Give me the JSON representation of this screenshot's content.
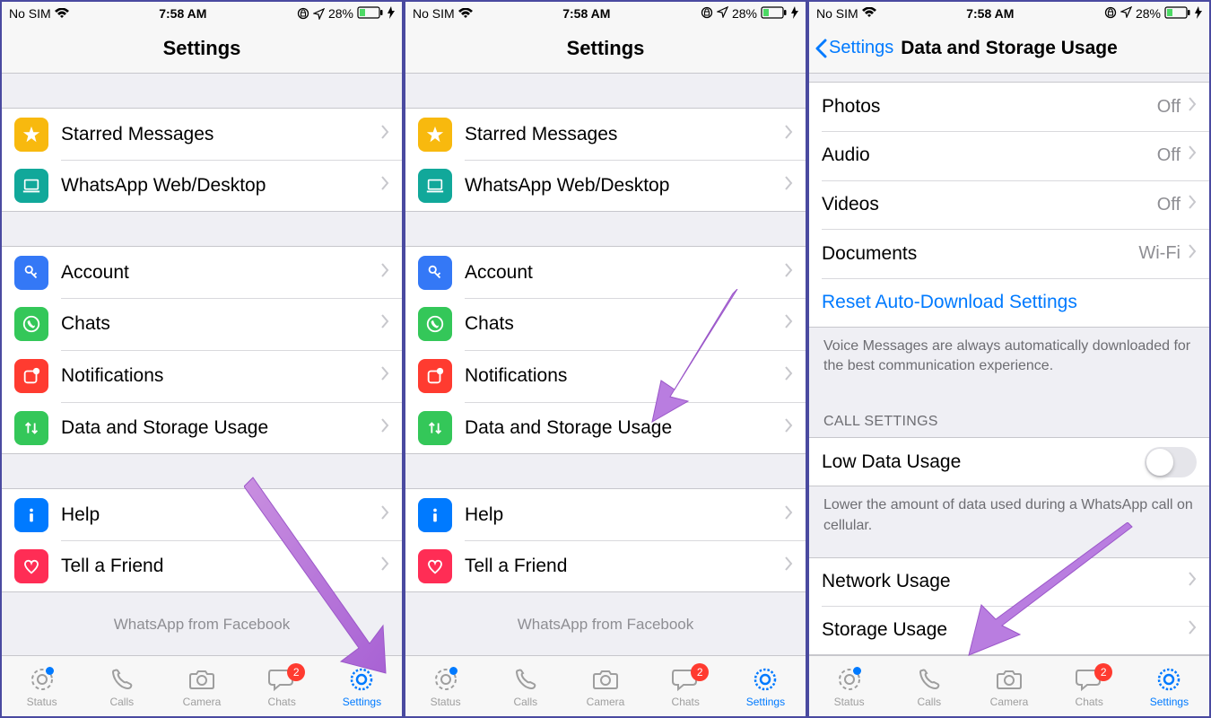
{
  "status_bar": {
    "carrier": "No SIM",
    "time": "7:58 AM",
    "battery_pct": "28%"
  },
  "screens": [
    {
      "nav": {
        "title": "Settings",
        "back": null
      },
      "brand": "WhatsApp from Facebook"
    },
    {
      "nav": {
        "title": "Settings",
        "back": null
      },
      "brand": "WhatsApp from Facebook"
    },
    {
      "nav": {
        "title": "Data and Storage Usage",
        "back": "Settings"
      }
    }
  ],
  "settings_group1": [
    {
      "label": "Starred Messages",
      "icon": "star",
      "color": "ic-yellow"
    },
    {
      "label": "WhatsApp Web/Desktop",
      "icon": "laptop",
      "color": "ic-teal"
    }
  ],
  "settings_group2": [
    {
      "label": "Account",
      "icon": "key",
      "color": "ic-blue"
    },
    {
      "label": "Chats",
      "icon": "whatsapp",
      "color": "ic-green"
    },
    {
      "label": "Notifications",
      "icon": "app-badge",
      "color": "ic-red"
    },
    {
      "label": "Data and Storage Usage",
      "icon": "arrows",
      "color": "ic-green"
    }
  ],
  "settings_group3": [
    {
      "label": "Help",
      "icon": "info",
      "color": "ic-info"
    },
    {
      "label": "Tell a Friend",
      "icon": "heart",
      "color": "ic-pink"
    }
  ],
  "data_usage": {
    "media": [
      {
        "label": "Photos",
        "value": "Off"
      },
      {
        "label": "Audio",
        "value": "Off"
      },
      {
        "label": "Videos",
        "value": "Off"
      },
      {
        "label": "Documents",
        "value": "Wi-Fi"
      }
    ],
    "reset_label": "Reset Auto-Download Settings",
    "voice_footer": "Voice Messages are always automatically downloaded for the best communication experience.",
    "call_header": "CALL SETTINGS",
    "low_data_label": "Low Data Usage",
    "low_data_footer": "Lower the amount of data used during a WhatsApp call on cellular.",
    "usage": [
      {
        "label": "Network Usage"
      },
      {
        "label": "Storage Usage"
      }
    ]
  },
  "tabs": [
    {
      "label": "Status",
      "icon": "status",
      "dot": true
    },
    {
      "label": "Calls",
      "icon": "phone"
    },
    {
      "label": "Camera",
      "icon": "camera"
    },
    {
      "label": "Chats",
      "icon": "chat",
      "badge": "2"
    },
    {
      "label": "Settings",
      "icon": "gear",
      "active": true
    }
  ]
}
